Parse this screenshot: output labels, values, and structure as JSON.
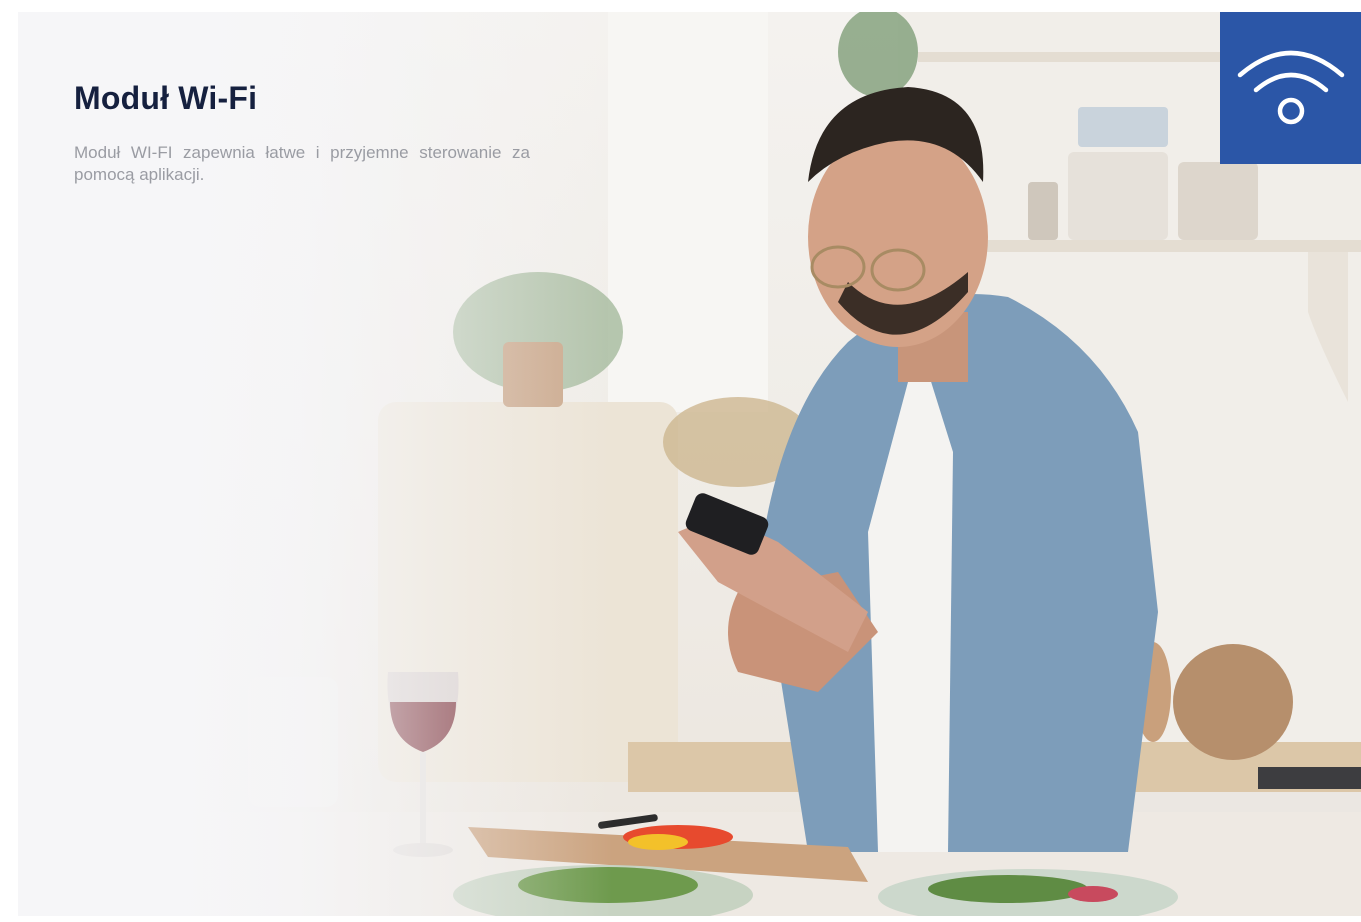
{
  "section": {
    "title": "Moduł Wi-Fi",
    "description": "Moduł WI-FI zapewnia łatwe i przyjemne sterowanie za pomocą aplikacji."
  },
  "badge": {
    "icon": "wifi-icon",
    "color": "#2b56a7"
  },
  "colors": {
    "title": "#15203f",
    "description": "#9a9ca3"
  },
  "photo": {
    "subject": "kitchen-scene"
  }
}
